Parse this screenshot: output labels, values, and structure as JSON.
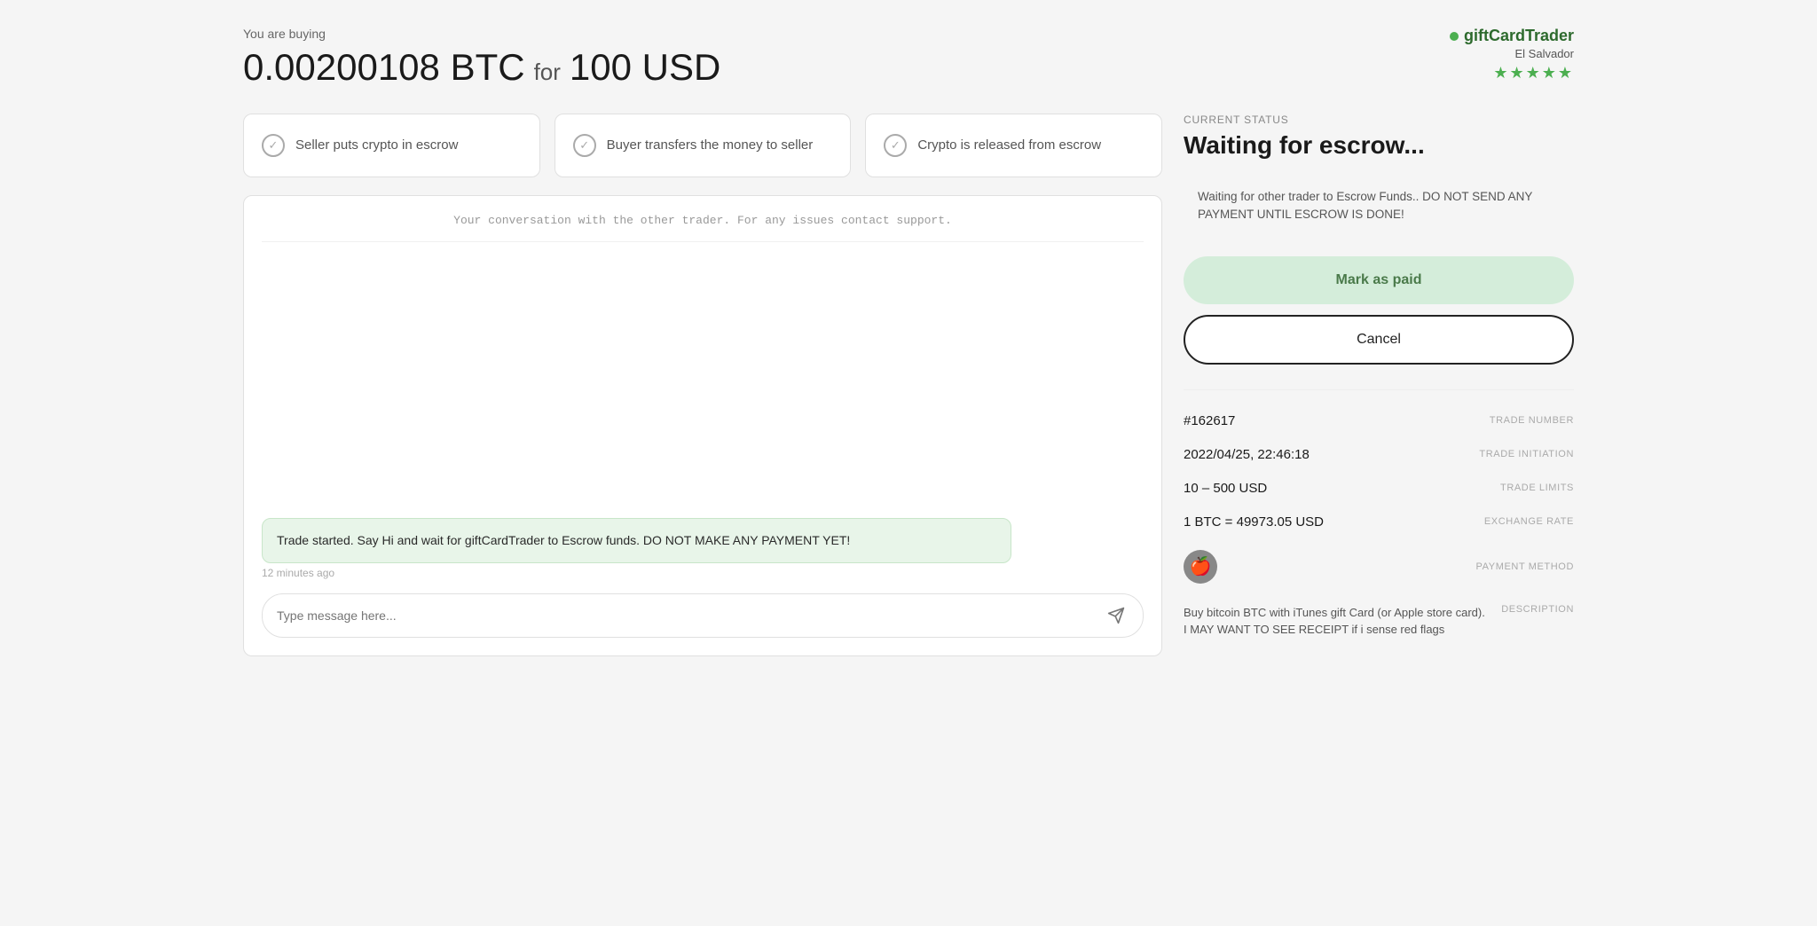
{
  "header": {
    "you_are_buying": "You are buying",
    "crypto_amount": "0.00200108 BTC",
    "for_word": "for",
    "fiat_amount": "100 USD",
    "brand_name": "giftCardTrader",
    "location": "El Salvador",
    "stars": "★★★★★"
  },
  "steps": [
    {
      "label": "Seller puts crypto in escrow",
      "check": "✓"
    },
    {
      "label": "Buyer transfers the money to seller",
      "check": "✓"
    },
    {
      "label": "Crypto is released from escrow",
      "check": "✓"
    }
  ],
  "chat": {
    "header_text": "Your conversation with the other trader. For any issues contact support.",
    "bubble_text": "Trade started. Say Hi and wait for giftCardTrader to Escrow funds. DO NOT MAKE ANY PAYMENT YET!",
    "bubble_time": "12 minutes ago",
    "input_placeholder": "Type message here..."
  },
  "status": {
    "label": "CURRENT STATUS",
    "title": "Waiting for escrow...",
    "warning": "Waiting for other trader to Escrow Funds.. DO NOT SEND ANY PAYMENT UNTIL ESCROW IS DONE!",
    "mark_paid_label": "Mark as paid",
    "cancel_label": "Cancel"
  },
  "trade_info": {
    "trade_number_value": "#162617",
    "trade_number_label": "TRADE NUMBER",
    "trade_initiation_value": "2022/04/25, 22:46:18",
    "trade_initiation_label": "TRADE INITIATION",
    "trade_limits_value": "10 – 500 USD",
    "trade_limits_label": "TRADE LIMITS",
    "exchange_rate_value": "1 BTC = 49973.05 USD",
    "exchange_rate_label": "EXCHANGE RATE",
    "payment_method_label": "PAYMENT METHOD",
    "payment_icon": "🍎",
    "description_text": "Buy bitcoin BTC with iTunes gift Card (or Apple store card). I MAY WANT TO SEE RECEIPT if i sense red flags",
    "description_label": "DESCRIPTION"
  },
  "colors": {
    "green_accent": "#4caf50",
    "brand_green": "#2d6a2d"
  }
}
